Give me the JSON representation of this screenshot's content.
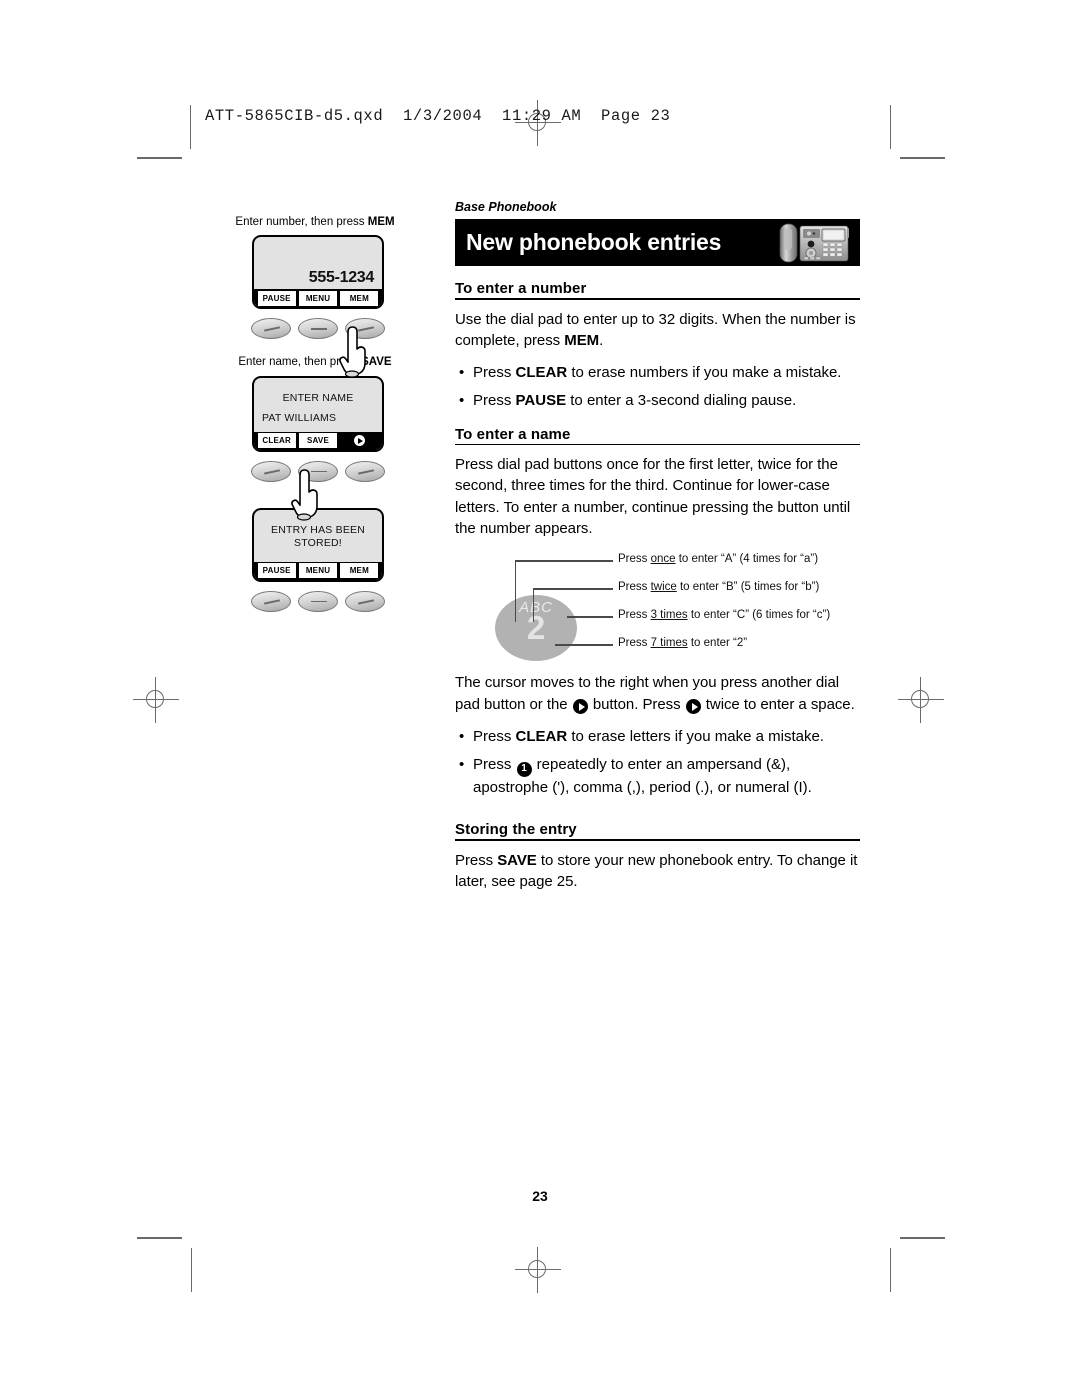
{
  "print_header": "ATT-5865CIB-d5.qxd  1/3/2004  11:29 AM  Page 23",
  "eyebrow": "Base Phonebook",
  "banner": {
    "title": "New phonebook entries",
    "phone_icon": "cordless-phone-base-image",
    "bg_color": "#000000",
    "text_color": "#ffffff"
  },
  "diagrams": [
    {
      "caption_plain": "Enter number, then press ",
      "caption_bold": "MEM",
      "screen_number": "555-1234",
      "softkeys": [
        "PAUSE",
        "MENU",
        "MEM"
      ],
      "hand_on_button": 3
    },
    {
      "caption_plain": "Enter name, then press ",
      "caption_bold": "SAVE",
      "screen_line1": "ENTER NAME",
      "screen_line2": "PAT WILLIAMS",
      "softkeys": [
        "CLEAR",
        "SAVE",
        "play-arrow-icon"
      ],
      "hand_on_button": 2
    },
    {
      "caption_plain": "",
      "caption_bold": "",
      "screen_line1": "ENTRY HAS BEEN",
      "screen_line2": "STORED!",
      "softkeys": [
        "PAUSE",
        "MENU",
        "MEM"
      ],
      "hand_on_button": 0
    }
  ],
  "sections": [
    {
      "heading": "To enter a number",
      "paragraph_a": "Use the dial pad to enter up to 32 digits. When the number is complete, press ",
      "paragraph_a_bold": "MEM",
      "paragraph_a_tail": ".",
      "bullets": [
        {
          "pre": "Press ",
          "bold": "CLEAR",
          "post": " to erase numbers if you make a mistake."
        },
        {
          "pre": "Press ",
          "bold": "PAUSE",
          "post": " to enter a 3-second dialing pause."
        }
      ]
    },
    {
      "heading": "To enter a name",
      "paragraph": "Press dial pad buttons once for the first letter, twice for the second, three times for the third. Continue for lower-case letters. To enter a number, continue pressing the button until the number appears."
    },
    {
      "heading": "Storing the entry",
      "paragraph_a": "Press ",
      "paragraph_a_bold": "SAVE",
      "paragraph_a_tail": " to store your new phonebook entry. To change it later, see page 25."
    }
  ],
  "key_callout": {
    "key_letters": "ABC",
    "key_digit": "2",
    "key_color": "#b2b2b2",
    "labels": [
      {
        "pre": "Press ",
        "emph": "once",
        "post": " to enter “A” (4 times for “a”)"
      },
      {
        "pre": "Press ",
        "emph": "twice",
        "post": " to enter “B” (5 times for “b”)"
      },
      {
        "pre": "Press ",
        "emph": "3 times",
        "post": " to enter “C” (6 times for “c”)"
      },
      {
        "pre": "Press ",
        "emph": "7 times",
        "post": " to enter “2”"
      }
    ]
  },
  "cursor_paragraph": {
    "part1": "The cursor moves to the right when you press another dial pad button or the ",
    "part2": " button. Press ",
    "part3": " twice to enter a space."
  },
  "name_bullets": [
    {
      "pre": "Press ",
      "bold": "CLEAR",
      "post": " to erase letters if you make a mistake."
    },
    {
      "pre": "Press ",
      "glyph": "1",
      "post": " repeatedly to enter an ampersand (&), apostrophe ('), comma (,), period (.), or numeral (I)."
    }
  ],
  "bullet_char": "•",
  "page_number": "23"
}
